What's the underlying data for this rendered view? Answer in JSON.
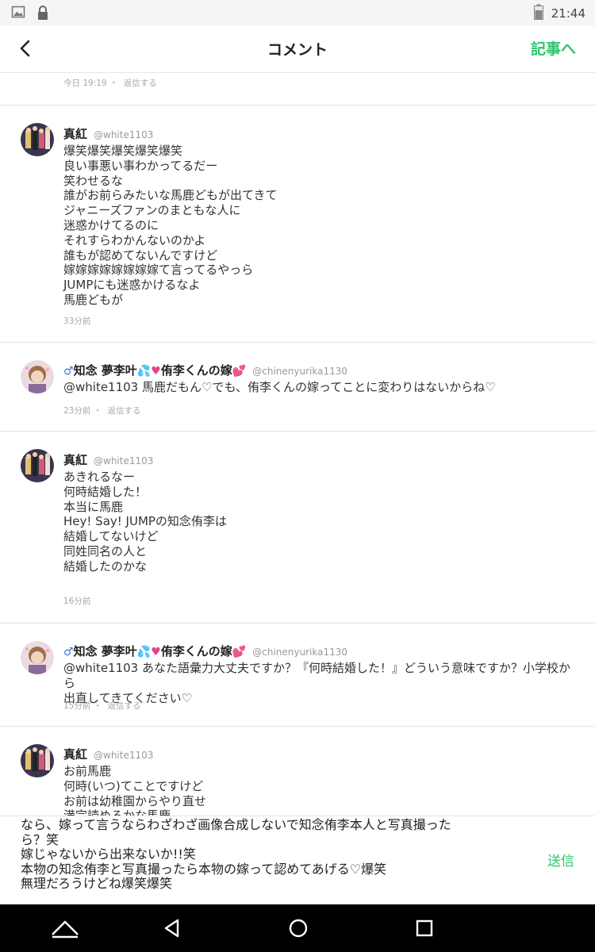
{
  "status_bar": {
    "time": "21:44",
    "icons": [
      "image-icon",
      "lock-icon",
      "battery-icon"
    ]
  },
  "header": {
    "title": "コメント",
    "to_article": "記事へ",
    "back_icon": "chevron-left-icon"
  },
  "comments": [
    {
      "meta": {
        "time": "今日 19:19",
        "sep": "・",
        "reply": "返信する"
      }
    },
    {
      "name": "真紅",
      "handle": "@white1103",
      "body": "爆笑爆笑爆笑爆笑爆笑\n良い事悪い事わかってるだー\n笑わせるな\n誰がお前らみたいな馬鹿どもが出てきて\nジャニーズファンのまともな人に\n迷惑かけてるのに\nそれすらわかんないのかよ\n誰もが認めてないんですけど\n嫁嫁嫁嫁嫁嫁嫁嫁て言ってるやっら\nJUMPにも迷惑かけるなよ\n馬鹿どもが",
      "meta": {
        "time": "33分前"
      }
    },
    {
      "name_a": "知念 夢李叶",
      "name_b": "侑李くんの嫁",
      "handle": "@chinenyurika1130",
      "body": "@white1103 馬鹿だもん♡でも、侑李くんの嫁ってことに変わりはないからね♡",
      "meta": {
        "time": "23分前",
        "sep": "・",
        "reply": "返信する"
      }
    },
    {
      "name": "真紅",
      "handle": "@white1103",
      "body": "あきれるなー\n何時結婚した！\n本当に馬鹿\nHey! Say! JUMPの知念侑李は\n結婚してないけど\n同姓同名の人と\n結婚したのかな",
      "meta": {
        "time": "16分前"
      }
    },
    {
      "name_a": "知念 夢李叶",
      "name_b": "侑李くんの嫁",
      "handle": "@chinenyurika1130",
      "body": "@white1103 あなた語彙力大丈夫ですか？『何時結婚した！』どういう意味ですか？小学校から\n出直してきてください♡",
      "meta": {
        "time": "15分前",
        "sep": "・",
        "reply": "返信する"
      }
    },
    {
      "name": "真紅",
      "handle": "@white1103",
      "body": "お前馬鹿\n何時(いつ)てことですけど\nお前は幼稚園からやり直せ\n満完読めるかな馬鹿"
    }
  ],
  "compose": {
    "text": "なら、嫁って言うならわざわざ画像合成しないで知念侑李本人と写真撮った\nら？笑\n嫁じゃないから出来ないか!!笑\n本物の知念侑李と写真撮ったら本物の嫁って認めてあげる♡爆笑\n無理だろうけどね爆笑爆笑",
    "send": "送信"
  },
  "navbar": {
    "icons": [
      "home-icon",
      "back-triangle-icon",
      "circle-home-icon",
      "recents-square-icon"
    ]
  },
  "colors": {
    "accent": "#2ec56a",
    "navbar": "#000000",
    "status_bar": "#f5f5f5"
  }
}
